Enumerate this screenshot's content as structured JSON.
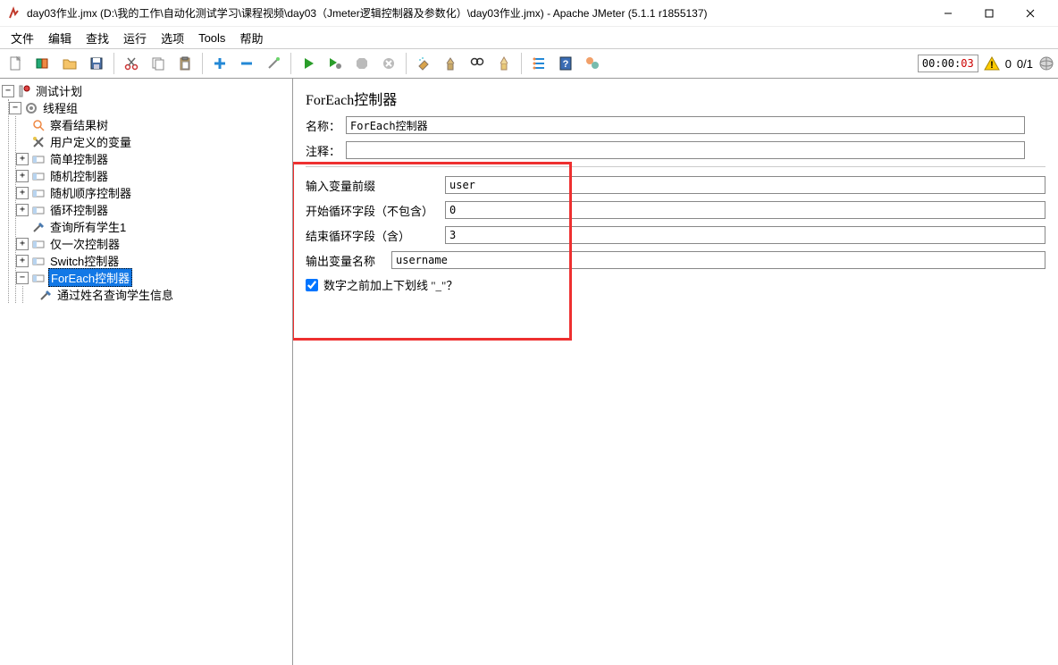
{
  "window": {
    "title": "day03作业.jmx (D:\\我的工作\\自动化测试学习\\课程视频\\day03（Jmeter逻辑控制器及参数化）\\day03作业.jmx) - Apache JMeter (5.1.1 r1855137)"
  },
  "menu": {
    "file": "文件",
    "edit": "编辑",
    "search": "查找",
    "run": "运行",
    "options": "选项",
    "tools": "Tools",
    "help": "帮助"
  },
  "toolbar": {
    "timer": "00:00:",
    "timer_sec": "03",
    "warn_count": "0",
    "thread_counts": "0/1"
  },
  "tree": {
    "root": "测试计划",
    "threadgroup": "线程组",
    "items": [
      "察看结果树",
      "用户定义的变量",
      "简单控制器",
      "随机控制器",
      "随机顺序控制器",
      "循环控制器",
      "查询所有学生1",
      "仅一次控制器",
      "Switch控制器",
      "ForEach控制器",
      "通过姓名查询学生信息"
    ]
  },
  "form": {
    "title": "ForEach控制器",
    "name_label": "名称：",
    "name_value": "ForEach控制器",
    "comment_label": "注释：",
    "comment_value": "",
    "prefix_label": "输入变量前缀",
    "prefix_value": "user",
    "start_label": "开始循环字段（不包含）",
    "start_value": "0",
    "end_label": "结束循环字段（含）",
    "end_value": "3",
    "output_label": "输出变量名称",
    "output_value": "username",
    "underscore_label": "数字之前加上下划线 \"_\"？"
  }
}
